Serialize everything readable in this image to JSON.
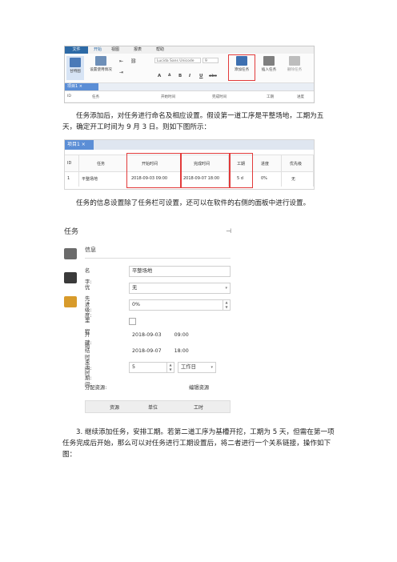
{
  "ribbon": {
    "menus": [
      "文件",
      "开始",
      "视图",
      "报表",
      "帮助"
    ],
    "buttons": {
      "gantt": "甘特图",
      "set_progress": "设置使用情况",
      "add_task": "添加任务",
      "insert_task": "插入任务",
      "delete_task": "删除任务"
    },
    "font_name": "Lucida Sans Unicode",
    "font_size": "9",
    "format_chars": [
      "A",
      "A",
      "B",
      "I",
      "U",
      "abc"
    ],
    "project_tab": "项目1",
    "headers": [
      "ID",
      "任务",
      "开始时间",
      "完成时间",
      "工期",
      "进度"
    ]
  },
  "para1": "任务添加后，对任务进行命名及相应设置。假设第一道工序是平整场地，工期为五天，确定开工时间为 9 月 3 日。则如下图所示：",
  "table": {
    "tab": "项目1",
    "headers": [
      "ID",
      "任务",
      "开始时间",
      "完成时间",
      "工期",
      "进度",
      "优先级"
    ],
    "row": [
      "1",
      "平整场地",
      "2018-09-03 09:00",
      "2018-09-07 18:00",
      "5 d",
      "0%",
      "无"
    ]
  },
  "para2": "任务的信息设置除了任务栏可设置，还可以在软件的右侧的面板中进行设置。",
  "panel": {
    "title": "任务",
    "section": "信息",
    "name_label": "名字:",
    "name_value": "平整场地",
    "priority_label": "优先级:",
    "priority_value": "无",
    "progress_label": "进度:",
    "progress_value": "0%",
    "milestone_label": "里程碑:",
    "start_label": "开始时间:",
    "start_date": "2018-09-03",
    "start_time": "09:00",
    "end_label": "结束时间:",
    "end_date": "2018-09-07",
    "end_time": "18:00",
    "duration_label": "工期:",
    "duration_value": "5",
    "duration_unit": "工作日",
    "assign_label": "分配资源:",
    "edit_label": "编辑资源",
    "res_headers": [
      "资源",
      "单位",
      "工时"
    ]
  },
  "para3": "3. 继续添加任务，安排工期。若第二道工序为基槽开挖，工期为 5 天，但需在第一项任务完成后开始，那么可以对任务进行工期设置后，将二者进行一个关系链接，操作如下图："
}
